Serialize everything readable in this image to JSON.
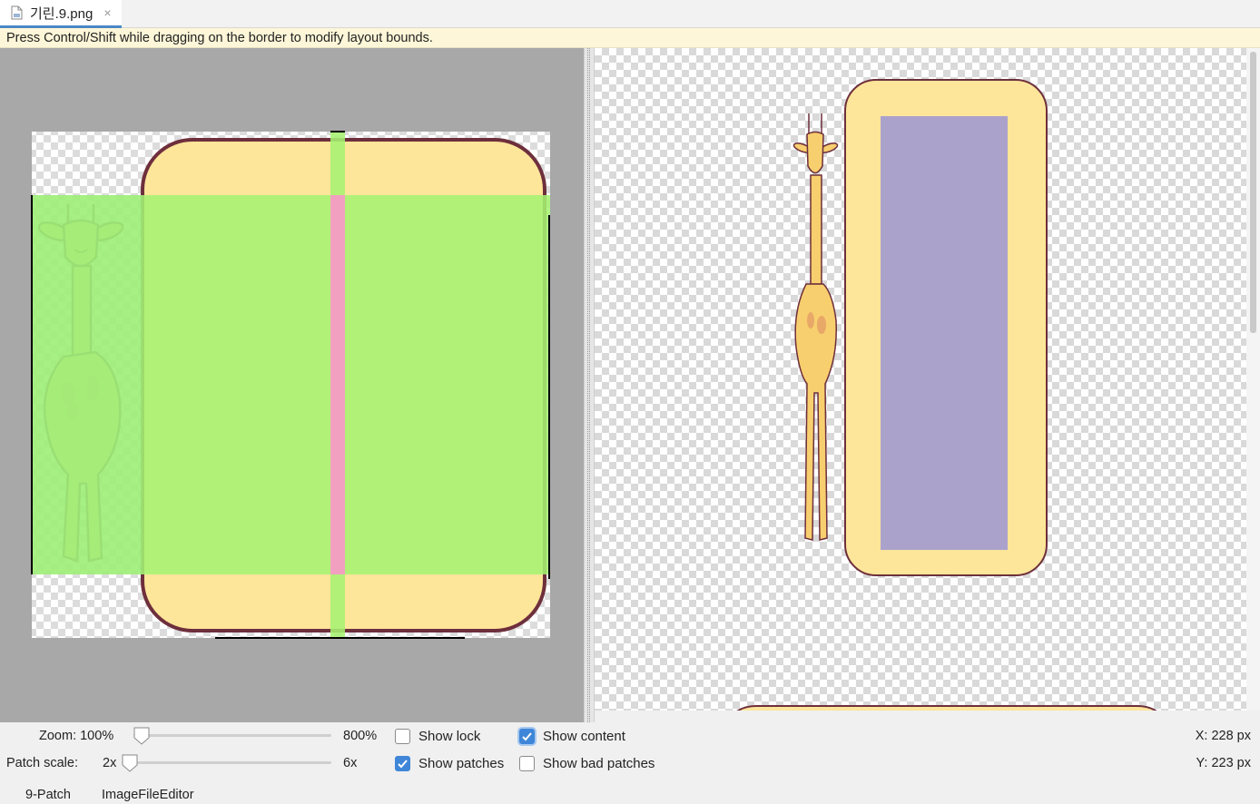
{
  "tab": {
    "label": "기린.9.png",
    "close": "×"
  },
  "hint": "Press Control/Shift while dragging on the border to modify layout bounds.",
  "controls": {
    "zoom_label": "Zoom: 100%",
    "zoom_max": "800%",
    "zoom_value_fraction": 0.0,
    "patch_scale_label": "Patch scale:",
    "patch_scale_min": "2x",
    "patch_scale_max": "6x",
    "patch_scale_value_fraction": 0.0,
    "show_lock": {
      "label": "Show lock",
      "checked": false
    },
    "show_patches": {
      "label": "Show patches",
      "checked": true
    },
    "show_content": {
      "label": "Show content",
      "checked": true
    },
    "show_bad_patches": {
      "label": "Show bad patches",
      "checked": false
    },
    "x_readout": "X: 228 px",
    "y_readout": "Y: 223 px"
  },
  "bottom_tabs": [
    "9-Patch",
    "ImageFileEditor"
  ],
  "colors": {
    "bubble_fill": "#fde59a",
    "bubble_border": "#6e2f3c",
    "patch_green": "#a6f272",
    "patch_pink": "#f59bc4",
    "content_purple": "#aba2cc",
    "editor_bg": "#a8a8a8",
    "accent": "#3f86d8"
  }
}
